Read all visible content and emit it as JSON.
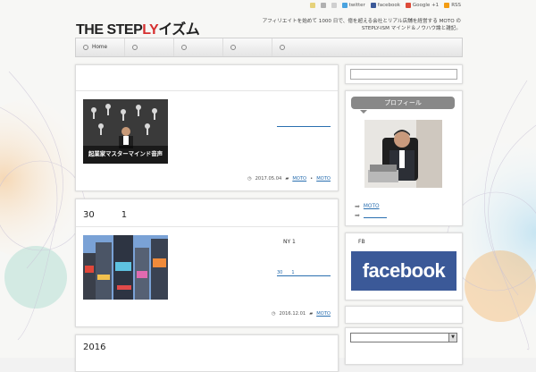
{
  "header": {
    "logo_dark": "THE STEP",
    "logo_red": "LY",
    "logo_rest": "イズム",
    "tagline": "アフィリエイトを始めて 1000 日で、億を超える会社とリアル店舗を経営する MOTO の STEPLY-ISM マインド＆ノウハウ論と雑記。",
    "social": [
      {
        "label": "twitter",
        "icon": "twitter-icon",
        "color": "#4aa3df"
      },
      {
        "label": "facebook",
        "icon": "facebook-icon",
        "color": "#3b5998"
      },
      {
        "label": "Google +1",
        "icon": "google-plus-icon",
        "color": "#dd4b39"
      },
      {
        "label": "RSS",
        "icon": "rss-icon",
        "color": "#f39c12"
      }
    ]
  },
  "nav": {
    "items": [
      "Home",
      "",
      "",
      "",
      ""
    ]
  },
  "posts": [
    {
      "title": "",
      "thumb_text": "起業家マスターマインド音声",
      "excerpt": "",
      "more": "",
      "date": "2017.05.04",
      "categories": [
        "MOTO",
        "MOTO"
      ]
    },
    {
      "title": "30　　　1",
      "excerpt": "NY 1",
      "more": "30　　1",
      "date": "2016.12.01",
      "categories": [
        "MOTO"
      ]
    },
    {
      "title": "2016"
    }
  ],
  "sidebar": {
    "profile_title": "プロフィール",
    "profile_links": [
      "MOTO",
      ""
    ],
    "fb_title": "FB",
    "fb_banner": "facebook"
  },
  "colors": {
    "accent_red": "#d63030",
    "link_blue": "#2a6fb0",
    "facebook_blue": "#3b5998"
  }
}
